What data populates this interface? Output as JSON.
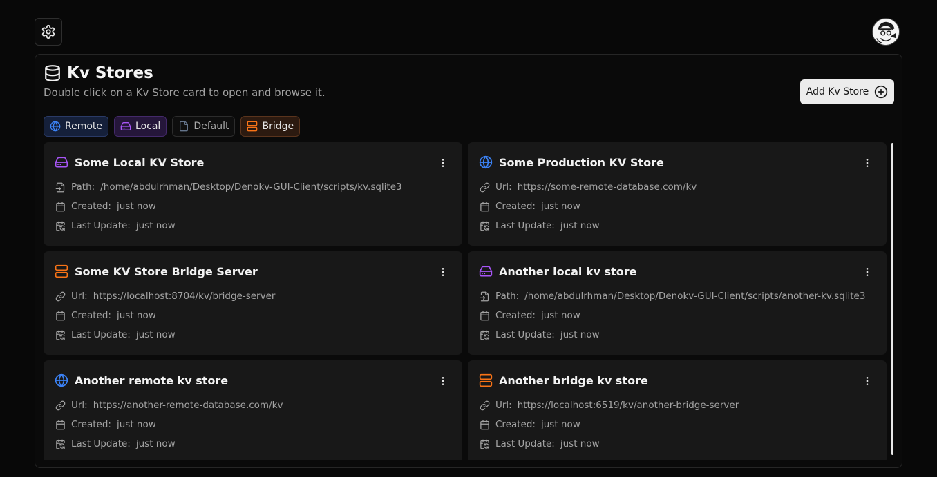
{
  "header": {
    "settings_icon": "gear-icon",
    "avatar_icon": "user-avatar"
  },
  "panel": {
    "title": "Kv Stores",
    "subtitle": "Double click on a Kv Store card to open and browse it.",
    "add_button_label": "Add Kv Store",
    "filters": [
      {
        "label": "Remote",
        "icon": "globe-icon",
        "color": "#3b82f6"
      },
      {
        "label": "Local",
        "icon": "hard-drive-icon",
        "color": "#a855f7"
      },
      {
        "label": "Default",
        "icon": "file-icon",
        "color": "#64748b"
      },
      {
        "label": "Bridge",
        "icon": "server-icon",
        "color": "#f97316"
      }
    ]
  },
  "labels": {
    "path": "Path:",
    "url": "Url:",
    "created": "Created:",
    "last_update": "Last Update:"
  },
  "cards": [
    {
      "name": "Some Local KV Store",
      "type": "local",
      "location_label": "Path:",
      "location": "/home/abdulrhman/Desktop/Denokv-GUI-Client/scripts/kv.sqlite3",
      "created": "just now",
      "updated": "just now"
    },
    {
      "name": "Some Production KV Store",
      "type": "remote",
      "location_label": "Url:",
      "location": "https://some-remote-database.com/kv",
      "created": "just now",
      "updated": "just now"
    },
    {
      "name": "Some KV Store Bridge Server",
      "type": "bridge",
      "location_label": "Url:",
      "location": "https://localhost:8704/kv/bridge-server",
      "created": "just now",
      "updated": "just now"
    },
    {
      "name": "Another local kv store",
      "type": "local",
      "location_label": "Path:",
      "location": "/home/abdulrhman/Desktop/Denokv-GUI-Client/scripts/another-kv.sqlite3",
      "created": "just now",
      "updated": "just now"
    },
    {
      "name": "Another remote kv store",
      "type": "remote",
      "location_label": "Url:",
      "location": "https://another-remote-database.com/kv",
      "created": "just now",
      "updated": "just now"
    },
    {
      "name": "Another bridge kv store",
      "type": "bridge",
      "location_label": "Url:",
      "location": "https://localhost:6519/kv/another-bridge-server",
      "created": "just now",
      "updated": "just now"
    }
  ],
  "colors": {
    "remote": "#3b82f6",
    "local": "#a855f7",
    "bridge": "#f97316"
  }
}
